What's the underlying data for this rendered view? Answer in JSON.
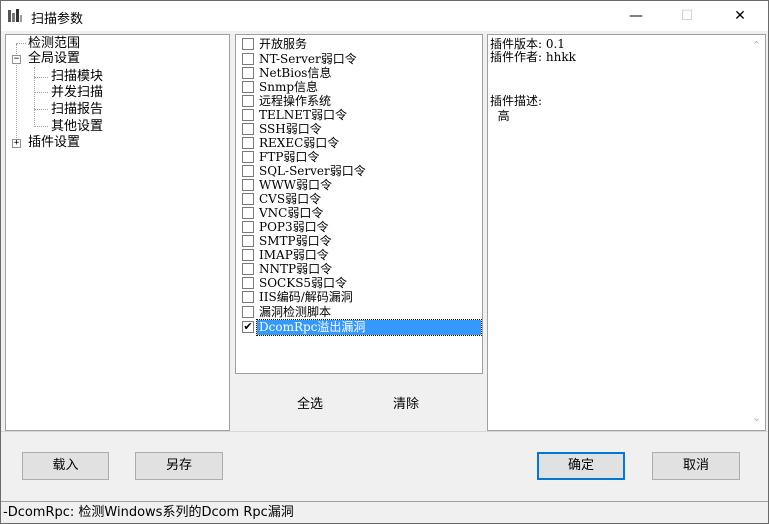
{
  "window": {
    "title": "扫描参数",
    "minimize_glyph": "—",
    "maximize_glyph": "☐",
    "close_glyph": "✕"
  },
  "tree": {
    "items": [
      {
        "label": "检测范围"
      },
      {
        "label": "全局设置",
        "expander": "−"
      },
      {
        "label": "扫描模块"
      },
      {
        "label": "并发扫描"
      },
      {
        "label": "扫描报告"
      },
      {
        "label": "其他设置"
      },
      {
        "label": "插件设置",
        "expander": "+"
      }
    ]
  },
  "plugins": {
    "items": [
      {
        "label": "开放服务",
        "checked": false
      },
      {
        "label": "NT-Server弱口令",
        "checked": false
      },
      {
        "label": "NetBios信息",
        "checked": false
      },
      {
        "label": "Snmp信息",
        "checked": false
      },
      {
        "label": "远程操作系统",
        "checked": false
      },
      {
        "label": "TELNET弱口令",
        "checked": false
      },
      {
        "label": "SSH弱口令",
        "checked": false
      },
      {
        "label": "REXEC弱口令",
        "checked": false
      },
      {
        "label": "FTP弱口令",
        "checked": false
      },
      {
        "label": "SQL-Server弱口令",
        "checked": false
      },
      {
        "label": "WWW弱口令",
        "checked": false
      },
      {
        "label": "CVS弱口令",
        "checked": false
      },
      {
        "label": "VNC弱口令",
        "checked": false
      },
      {
        "label": "POP3弱口令",
        "checked": false
      },
      {
        "label": "SMTP弱口令",
        "checked": false
      },
      {
        "label": "IMAP弱口令",
        "checked": false
      },
      {
        "label": "NNTP弱口令",
        "checked": false
      },
      {
        "label": "SOCKS5弱口令",
        "checked": false
      },
      {
        "label": "IIS编码/解码漏洞",
        "checked": false
      },
      {
        "label": "漏洞检测脚本",
        "checked": false
      },
      {
        "label": "DcomRpc溢出漏洞",
        "checked": true,
        "selected": true
      }
    ],
    "select_all": "全选",
    "clear": "清除",
    "check_glyph": "✔"
  },
  "detail": {
    "version": "插件版本: 0.1",
    "author": "插件作者: hhkk",
    "desc_label": "插件描述:",
    "desc_value": "  高",
    "scroll_up": "⌃",
    "scroll_down": "⌄"
  },
  "buttons": {
    "load": "载入",
    "save_as": "另存",
    "ok": "确定",
    "cancel": "取消"
  },
  "status": "-DcomRpc: 检测Windows系列的Dcom Rpc漏洞"
}
